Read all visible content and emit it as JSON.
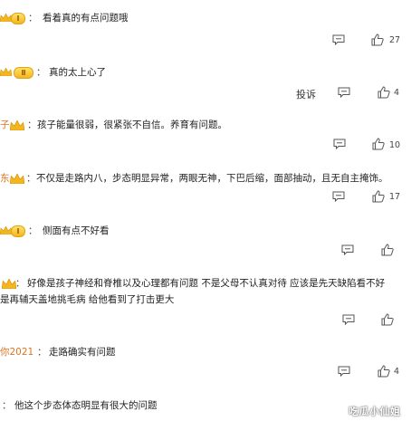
{
  "comments": [
    {
      "name": "",
      "badge": "Ⅰ",
      "colon": "：",
      "text": "看着真的有点问题哦",
      "likes": "27"
    },
    {
      "name": "",
      "badge": "Ⅱ",
      "colon": "：",
      "text": "真的太上心了",
      "likes": "4",
      "report": "投诉"
    },
    {
      "name": "子",
      "badge": "",
      "colon": "：",
      "text": "孩子能量很弱，很紧张不自信。养育有问题。",
      "likes": "10"
    },
    {
      "name": "",
      "badge": "",
      "colon": "：",
      "text": "不仅是走路内八，步态明显异常，两眼无神，下巴后缩，面部抽动，且无自主掩饰。",
      "likes": "17"
    },
    {
      "name": "",
      "badge": "Ⅰ",
      "colon": "：",
      "text": "侧面有点不好看",
      "likes": ""
    },
    {
      "name": "",
      "badge": "",
      "colon": "：",
      "text": "好像是孩子神经和脊椎以及心理都有问题 不是父母不认真对待 应该是先天缺陷看不好",
      "text2": "是再辅天盖地挑毛病 给他看到了打击更大",
      "likes": ""
    },
    {
      "name": "你2021",
      "badge": "",
      "colon": "：",
      "text": "走路确实有问题",
      "likes": "4"
    },
    {
      "name": "",
      "badge": "",
      "colon": "：",
      "text": "他这个步态体态明显有很大的问题",
      "likes": ""
    }
  ],
  "watermark": "吃瓜小仙姐"
}
